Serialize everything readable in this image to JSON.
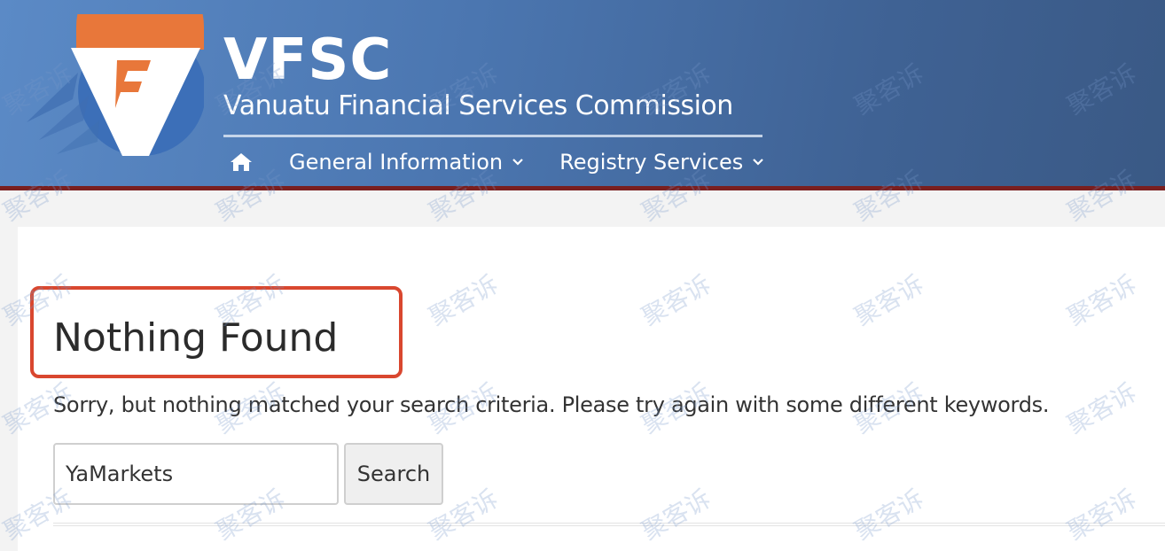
{
  "header": {
    "brand_name": "VFSC",
    "brand_subtitle": "Vanuatu Financial Services Commission",
    "logo_icon": "vfsc-logo-icon",
    "nav": {
      "home_icon": "home-icon",
      "items": [
        {
          "label": "General Information",
          "icon": "chevron-down-icon"
        },
        {
          "label": "Registry Services",
          "icon": "chevron-down-icon"
        }
      ]
    },
    "colors": {
      "bar_start": "#5b8ac6",
      "bar_end": "#3a5985",
      "bottom_border": "#7a1f1f",
      "logo_orange": "#e8773a",
      "logo_blue": "#3c6fb8"
    }
  },
  "main": {
    "title": "Nothing Found",
    "message": "Sorry, but nothing matched your search criteria. Please try again with some different keywords.",
    "search": {
      "value": "YaMarkets",
      "button_label": "Search"
    },
    "highlight_color": "#d9472f"
  },
  "watermark": {
    "text": "聚客诉"
  }
}
